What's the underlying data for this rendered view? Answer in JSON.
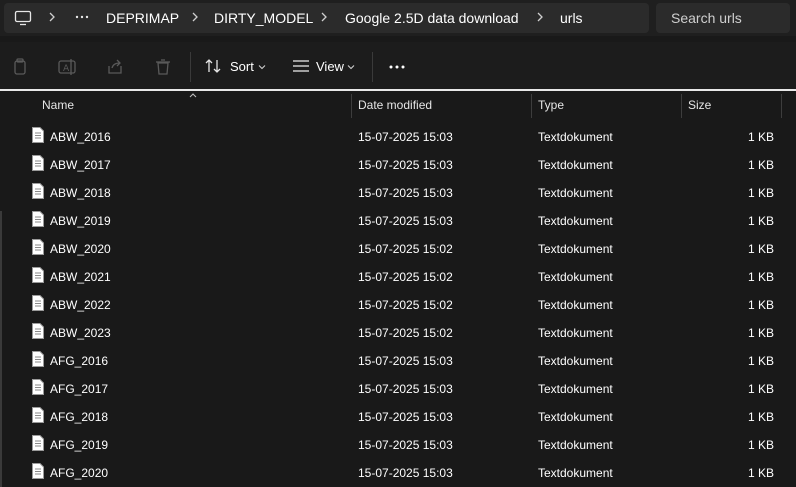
{
  "breadcrumb": [
    "DEPRIMAP",
    "DIRTY_MODEL",
    "Google 2.5D data download",
    "urls"
  ],
  "search": {
    "placeholder": "Search urls"
  },
  "toolbar": {
    "sort_label": "Sort",
    "view_label": "View"
  },
  "columns": {
    "name": "Name",
    "date": "Date modified",
    "type": "Type",
    "size": "Size"
  },
  "files": [
    {
      "name": "ABW_2016",
      "date": "15-07-2025 15:03",
      "type": "Textdokument",
      "size": "1 KB"
    },
    {
      "name": "ABW_2017",
      "date": "15-07-2025 15:03",
      "type": "Textdokument",
      "size": "1 KB"
    },
    {
      "name": "ABW_2018",
      "date": "15-07-2025 15:03",
      "type": "Textdokument",
      "size": "1 KB"
    },
    {
      "name": "ABW_2019",
      "date": "15-07-2025 15:03",
      "type": "Textdokument",
      "size": "1 KB"
    },
    {
      "name": "ABW_2020",
      "date": "15-07-2025 15:02",
      "type": "Textdokument",
      "size": "1 KB"
    },
    {
      "name": "ABW_2021",
      "date": "15-07-2025 15:02",
      "type": "Textdokument",
      "size": "1 KB"
    },
    {
      "name": "ABW_2022",
      "date": "15-07-2025 15:02",
      "type": "Textdokument",
      "size": "1 KB"
    },
    {
      "name": "ABW_2023",
      "date": "15-07-2025 15:02",
      "type": "Textdokument",
      "size": "1 KB"
    },
    {
      "name": "AFG_2016",
      "date": "15-07-2025 15:03",
      "type": "Textdokument",
      "size": "1 KB"
    },
    {
      "name": "AFG_2017",
      "date": "15-07-2025 15:03",
      "type": "Textdokument",
      "size": "1 KB"
    },
    {
      "name": "AFG_2018",
      "date": "15-07-2025 15:03",
      "type": "Textdokument",
      "size": "1 KB"
    },
    {
      "name": "AFG_2019",
      "date": "15-07-2025 15:03",
      "type": "Textdokument",
      "size": "1 KB"
    },
    {
      "name": "AFG_2020",
      "date": "15-07-2025 15:03",
      "type": "Textdokument",
      "size": "1 KB"
    }
  ]
}
